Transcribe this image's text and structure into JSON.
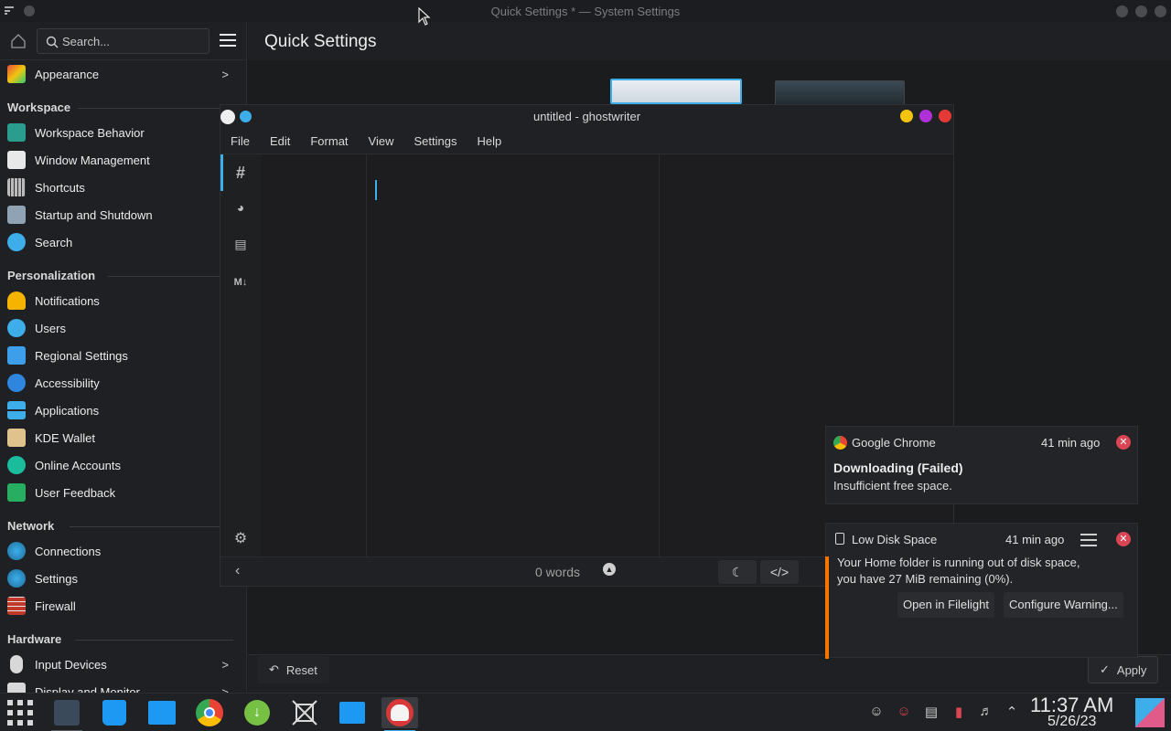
{
  "window": {
    "title": "Quick Settings * — System Settings",
    "page_title": "Quick Settings"
  },
  "sidebar": {
    "search_placeholder": "Search...",
    "top_item": "Appearance",
    "sections": {
      "workspace": "Workspace",
      "personalization": "Personalization",
      "network": "Network",
      "hardware": "Hardware"
    },
    "workspace_items": [
      "Workspace Behavior",
      "Window Management",
      "Shortcuts",
      "Startup and Shutdown",
      "Search"
    ],
    "personalization_items": [
      "Notifications",
      "Users",
      "Regional Settings",
      "Accessibility",
      "Applications",
      "KDE Wallet",
      "Online Accounts",
      "User Feedback"
    ],
    "network_items": [
      "Connections",
      "Settings",
      "Firewall"
    ],
    "hardware_items": [
      "Input Devices",
      "Display and Monitor"
    ]
  },
  "footer": {
    "reset_label": "Reset",
    "apply_label": "Apply"
  },
  "ghostwriter": {
    "title": "untitled - ghostwriter",
    "menu": [
      "File",
      "Edit",
      "Format",
      "View",
      "Settings",
      "Help"
    ],
    "word_count": "0 words"
  },
  "notifications": [
    {
      "app": "Google Chrome",
      "time": "41 min ago",
      "summary": "Downloading (Failed)",
      "body": "Insufficient free space."
    },
    {
      "app": "Low Disk Space",
      "time": "41 min ago",
      "body_line1": "Your Home folder is running out of disk space,",
      "body_line2": "you have 27 MiB remaining (0%).",
      "action1": "Open in Filelight",
      "action2": "Configure Warning..."
    }
  ],
  "clock": {
    "time": "11:37 AM",
    "date": "5/26/23"
  },
  "colors": {
    "accent": "#3daee9",
    "close": "#da4453",
    "warning": "#f67400"
  }
}
